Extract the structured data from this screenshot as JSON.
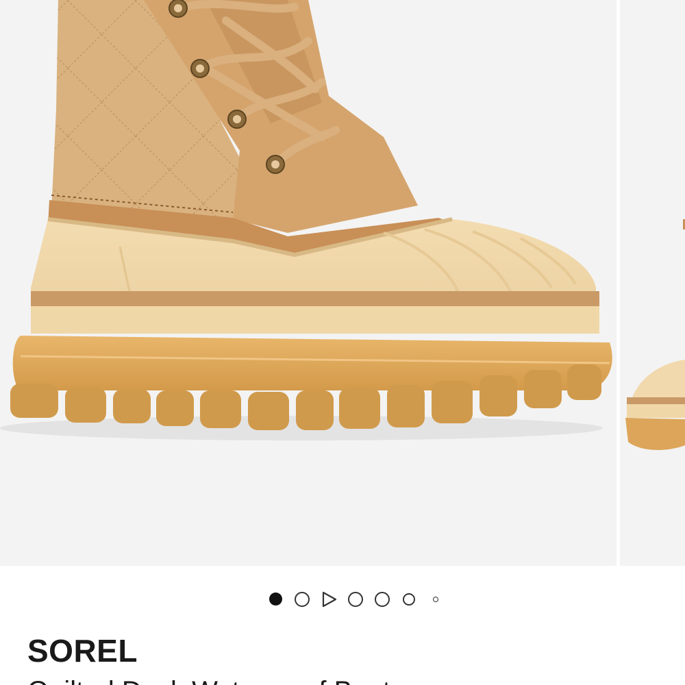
{
  "carousel": {
    "main_image": "sorel-quilted-boot-front-view",
    "next_image": "sorel-quilted-boot-side-view",
    "background_color": "#f3f3f3"
  },
  "pager": {
    "total": 7,
    "active_index": 0,
    "video_index": 2
  },
  "product": {
    "brand": "SOREL",
    "name": "Quilted Duck Waterproof Boot"
  }
}
